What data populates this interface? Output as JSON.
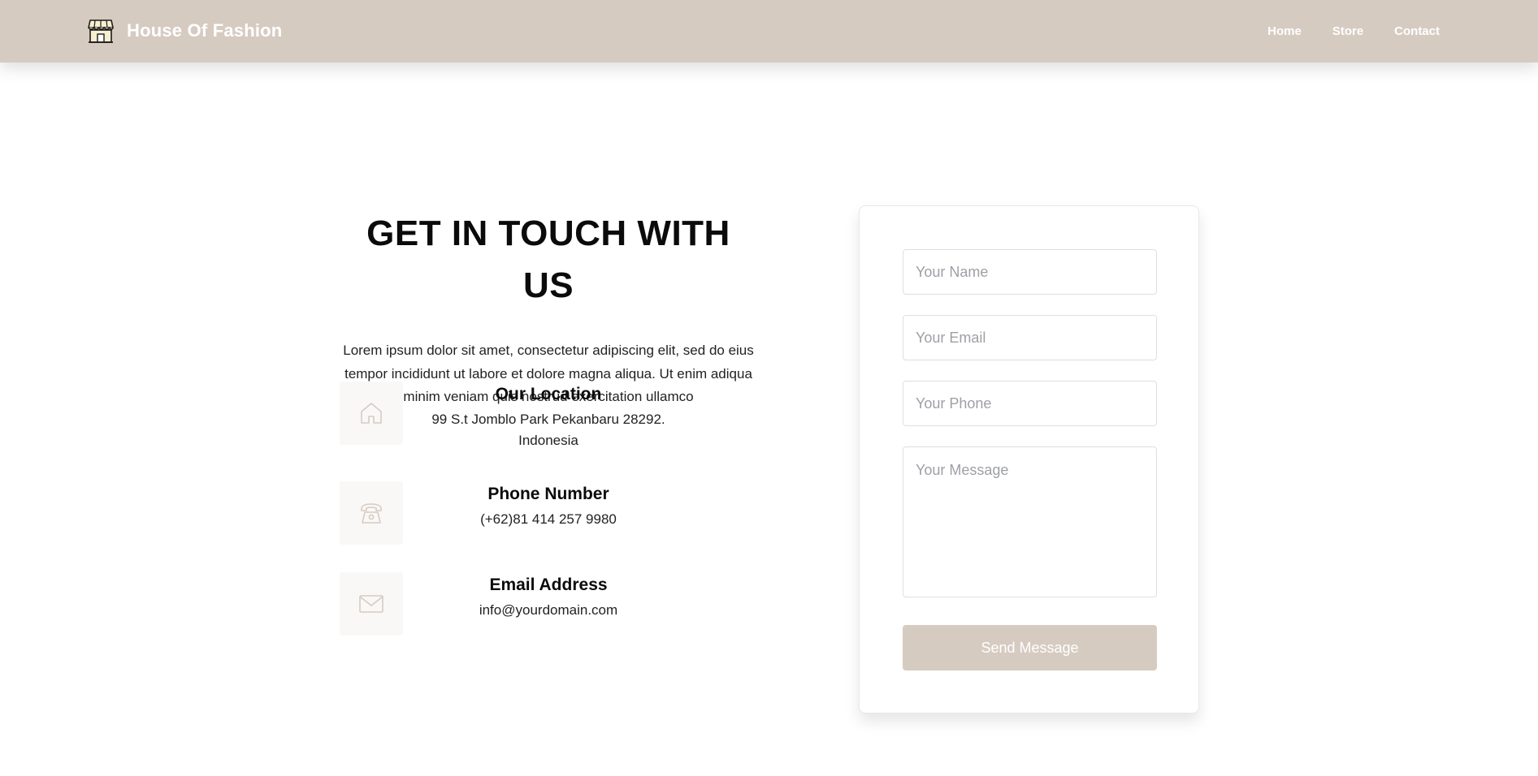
{
  "header": {
    "brand_title": "House Of Fashion",
    "brand_icon": "store-icon",
    "background_color": "#d6cbc1",
    "nav": [
      {
        "label": "Home"
      },
      {
        "label": "Store"
      },
      {
        "label": "Contact"
      }
    ]
  },
  "contact": {
    "headline": "GET IN TOUCH WITH US",
    "intro": "Lorem ipsum dolor sit amet, consectetur adipiscing elit, sed do eius tempor incididunt ut labore et dolore magna aliqua. Ut enim adiqua minim veniam quis nostrud exercitation ullamco",
    "location": {
      "icon": "home-icon",
      "title": "Our Location",
      "value": "99 S.t Jomblo Park Pekanbaru 28292. Indonesia"
    },
    "phone": {
      "icon": "phone-icon",
      "title": "Phone Number",
      "value": "(+62)81 414 257 9980"
    },
    "email": {
      "icon": "mail-icon",
      "title": "Email Address",
      "value": "info@yourdomain.com"
    }
  },
  "form": {
    "name_placeholder": "Your Name",
    "email_placeholder": "Your Email",
    "phone_placeholder": "Your Phone",
    "message_placeholder": "Your Message",
    "submit_label": "Send Message",
    "accent_color": "#d6cbc1"
  }
}
